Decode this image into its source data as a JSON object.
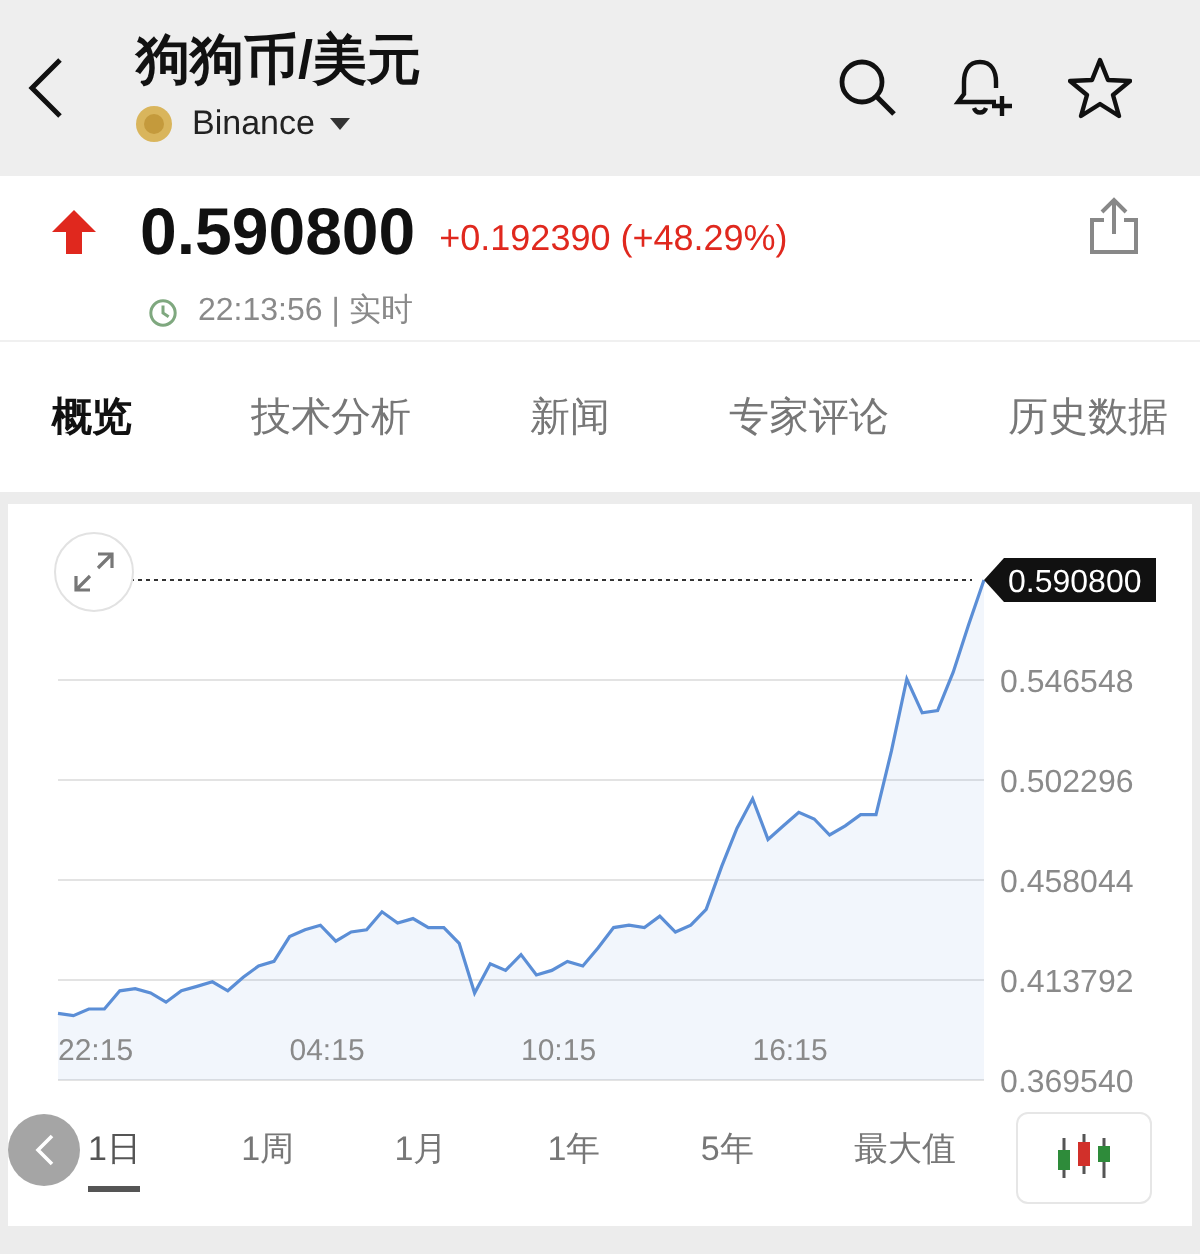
{
  "header": {
    "title": "狗狗币/美元",
    "exchange": "Binance"
  },
  "quote": {
    "price": "0.590800",
    "change": "+0.192390 (+48.29%)",
    "time": "22:13:56 | 实时"
  },
  "tabs": [
    {
      "label": "概览",
      "selected": true
    },
    {
      "label": "技术分析",
      "selected": false
    },
    {
      "label": "新闻",
      "selected": false
    },
    {
      "label": "专家评论",
      "selected": false
    },
    {
      "label": "历史数据",
      "selected": false
    }
  ],
  "chart": {
    "current_label": "0.590800",
    "time_labels": [
      "22:15",
      "04:15",
      "10:15",
      "16:15"
    ],
    "chart_data": {
      "type": "area",
      "grid": true,
      "ylim": [
        0.36954,
        0.5908
      ],
      "yticks": [
        {
          "value": 0.36954,
          "label": "0.369540"
        },
        {
          "value": 0.413792,
          "label": "0.413792"
        },
        {
          "value": 0.458044,
          "label": "0.458044"
        },
        {
          "value": 0.502296,
          "label": "0.502296"
        },
        {
          "value": 0.546548,
          "label": "0.546548"
        }
      ],
      "series": [
        {
          "color": "#5b8ed6",
          "values": [
            0.399,
            0.398,
            0.401,
            0.401,
            0.409,
            0.41,
            0.408,
            0.404,
            0.409,
            0.411,
            0.413,
            0.409,
            0.415,
            0.42,
            0.422,
            0.433,
            0.436,
            0.438,
            0.431,
            0.435,
            0.436,
            0.444,
            0.439,
            0.441,
            0.437,
            0.437,
            0.43,
            0.408,
            0.421,
            0.418,
            0.425,
            0.416,
            0.418,
            0.422,
            0.42,
            0.428,
            0.437,
            0.438,
            0.437,
            0.442,
            0.435,
            0.438,
            0.445,
            0.464,
            0.481,
            0.494,
            0.476,
            0.482,
            0.488,
            0.485,
            0.478,
            0.482,
            0.487,
            0.487,
            0.515,
            0.547,
            0.532,
            0.533,
            0.55,
            0.571,
            0.5908
          ]
        }
      ]
    }
  },
  "ranges": [
    {
      "label": "1日",
      "selected": true
    },
    {
      "label": "1周",
      "selected": false
    },
    {
      "label": "1月",
      "selected": false
    },
    {
      "label": "1年",
      "selected": false
    },
    {
      "label": "5年",
      "selected": false
    },
    {
      "label": "最大值",
      "selected": false
    }
  ]
}
